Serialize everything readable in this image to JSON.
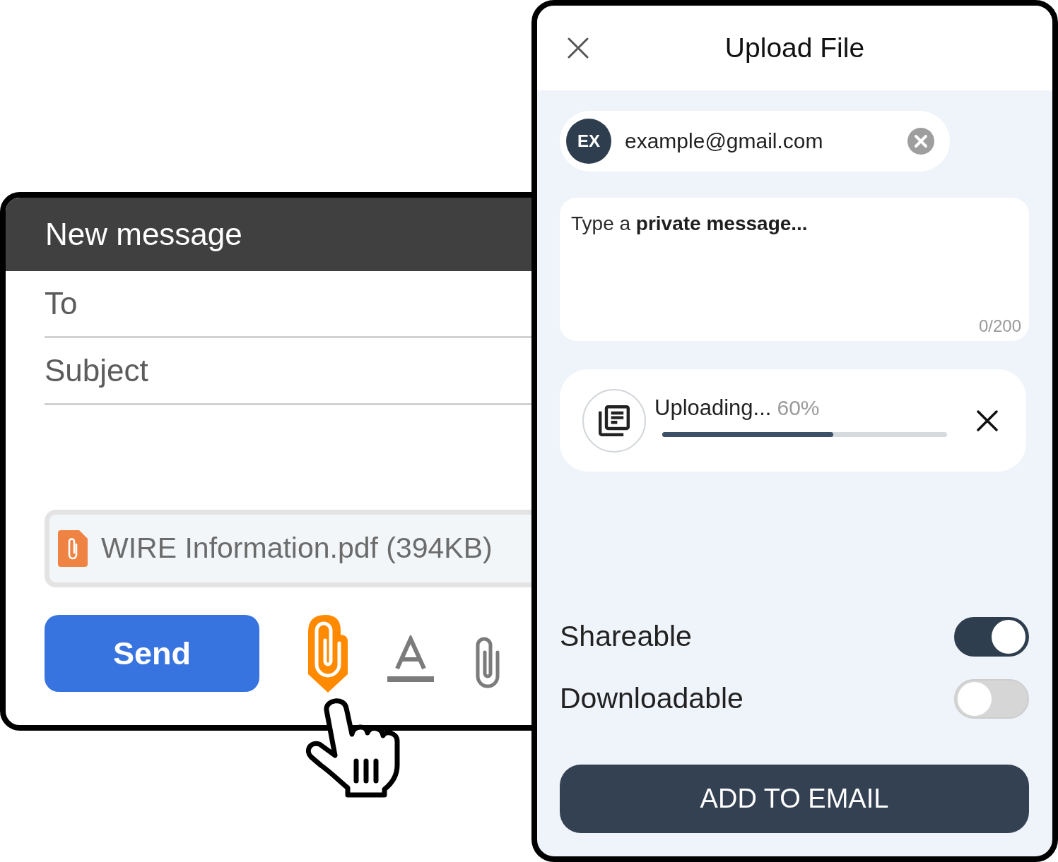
{
  "compose": {
    "title": "New message",
    "fields": [
      {
        "placeholder": "To"
      },
      {
        "placeholder": "Subject"
      }
    ],
    "attachment": {
      "name": "WIRE Information.pdf (394KB)"
    },
    "send": "Send",
    "toolbar": [
      {
        "kind": "clip",
        "selected": true
      },
      {
        "kind": "text",
        "selected": false
      },
      {
        "kind": "clip",
        "selected": false
      }
    ]
  },
  "upload": {
    "title": "Upload File",
    "recipient": {
      "initials": "EX",
      "email": "example@gmail.com"
    },
    "message": {
      "placeholder": "Type a **private message...**",
      "counter": "0/200"
    },
    "progress": {
      "label": "Uploading...",
      "percent": "60%",
      "level": 0.6
    },
    "options": [
      {
        "label": "Shareable",
        "on": true
      },
      {
        "label": "Downloadable",
        "on": false
      }
    ],
    "button": "ADD TO EMAIL"
  }
}
